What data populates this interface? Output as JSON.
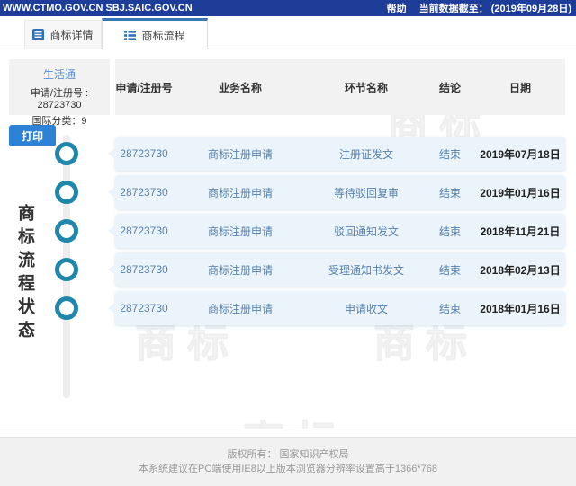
{
  "topbar": {
    "domains": "WWW.CTMO.GOV.CN SBJ.SAIC.GOV.CN",
    "help": "帮助",
    "cutoff": "当前数据截至： (2019年09月28日)"
  },
  "tabs": [
    {
      "label": "商标详情"
    },
    {
      "label": "商标流程"
    }
  ],
  "info_card": {
    "brand": "生活通",
    "reg_line": "申请/注册号 : 28723730",
    "class_line": "国际分类：9"
  },
  "print_label": "打印",
  "vertical_title": "商标流程状态",
  "watermark_text": "商标",
  "table": {
    "headers": [
      "申请/注册号",
      "业务名称",
      "环节名称",
      "结论",
      "日期"
    ],
    "rows": [
      {
        "reg_no": "28723730",
        "business": "商标注册申请",
        "stage": "注册证发文",
        "result": "结束",
        "date": "2019年07月18日"
      },
      {
        "reg_no": "28723730",
        "business": "商标注册申请",
        "stage": "等待驳回复审",
        "result": "结束",
        "date": "2019年01月16日"
      },
      {
        "reg_no": "28723730",
        "business": "商标注册申请",
        "stage": "驳回通知发文",
        "result": "结束",
        "date": "2018年11月21日"
      },
      {
        "reg_no": "28723730",
        "business": "商标注册申请",
        "stage": "受理通知书发文",
        "result": "结束",
        "date": "2018年02月13日"
      },
      {
        "reg_no": "28723730",
        "business": "商标注册申请",
        "stage": "申请收文",
        "result": "结束",
        "date": "2018年01月16日"
      }
    ]
  },
  "footer": {
    "line1": "版权所有： 国家知识产权局",
    "line2": "本系统建议在PC端使用IE8以上版本浏览器分辨率设置高于1366*768"
  },
  "colors": {
    "topbar_bg": "#1d3d98",
    "accent_blue": "#2e82d6",
    "tab_active_border": "#3a74b8",
    "row_bg": "#ebf4fa",
    "row_text": "#5580ad",
    "node_ring": "#1f87ab"
  }
}
